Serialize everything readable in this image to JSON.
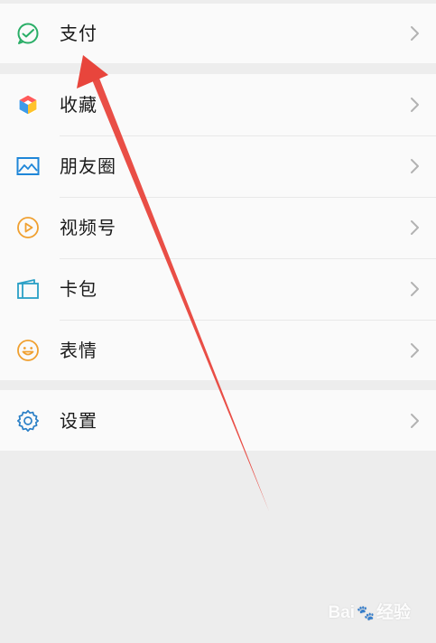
{
  "groups": [
    {
      "items": [
        {
          "label": "支付",
          "icon": "pay-icon"
        }
      ]
    },
    {
      "items": [
        {
          "label": "收藏",
          "icon": "favorites-icon"
        },
        {
          "label": "朋友圈",
          "icon": "moments-icon"
        },
        {
          "label": "视频号",
          "icon": "channels-icon"
        },
        {
          "label": "卡包",
          "icon": "cards-icon"
        },
        {
          "label": "表情",
          "icon": "stickers-icon"
        }
      ]
    },
    {
      "items": [
        {
          "label": "设置",
          "icon": "settings-icon"
        }
      ]
    }
  ],
  "annotation": {
    "color": "#e8453c"
  },
  "watermark": {
    "text": "Bai",
    "suffix": "经验",
    "paw": "🐾"
  },
  "colors": {
    "pay": "#2aae67",
    "favorites": "#ff9e1b",
    "moments": "#1f86d8",
    "channels": "#f0a030",
    "cards": "#2aa0c6",
    "stickers": "#f0a030",
    "settings": "#2a7fc6"
  }
}
